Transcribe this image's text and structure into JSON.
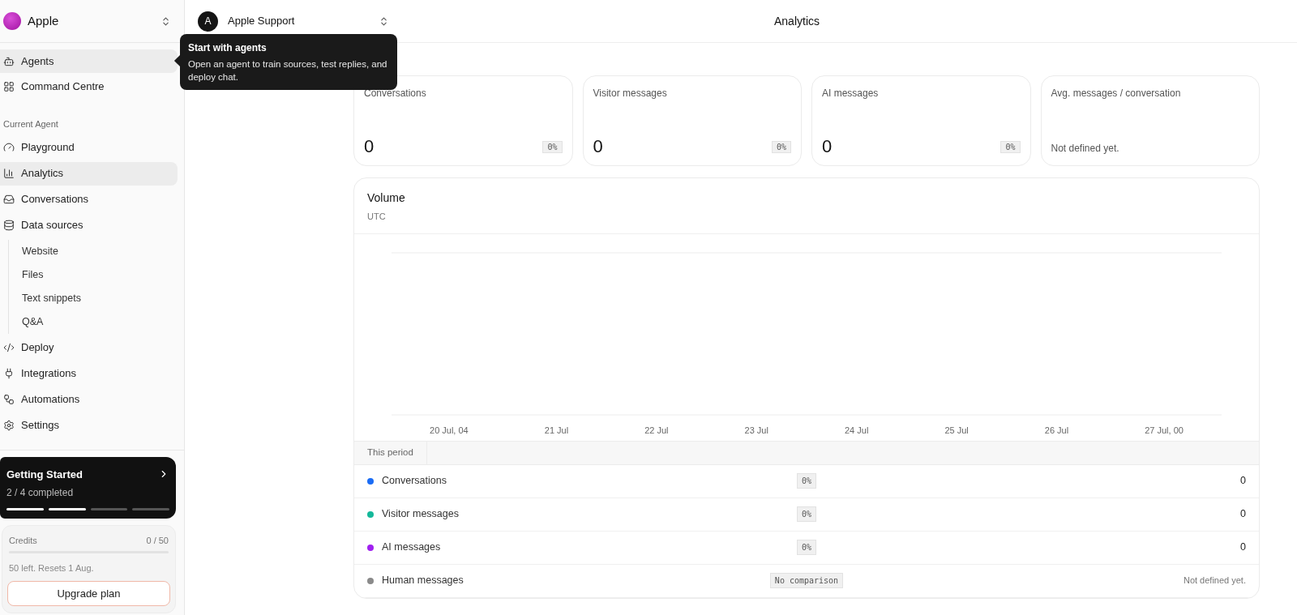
{
  "workspace": {
    "name": "Apple"
  },
  "agent": {
    "initial": "A",
    "name": "Apple Support"
  },
  "page_title": "Analytics",
  "tooltip": {
    "title": "Start with agents",
    "text": "Open an agent to train sources, test replies, and deploy chat."
  },
  "sidebar": {
    "items": [
      {
        "label": "Agents",
        "selected": true
      },
      {
        "label": "Command Centre",
        "selected": false
      }
    ],
    "section": "Current Agent",
    "agent_items": [
      {
        "label": "Playground",
        "selected": false
      },
      {
        "label": "Analytics",
        "selected": true
      },
      {
        "label": "Conversations",
        "selected": false
      },
      {
        "label": "Data sources",
        "selected": false,
        "children": [
          {
            "label": "Website"
          },
          {
            "label": "Files"
          },
          {
            "label": "Text snippets"
          },
          {
            "label": "Q&A"
          }
        ]
      },
      {
        "label": "Deploy",
        "selected": false
      },
      {
        "label": "Integrations",
        "selected": false
      },
      {
        "label": "Automations",
        "selected": false
      },
      {
        "label": "Settings",
        "selected": false
      }
    ]
  },
  "getting_started": {
    "title": "Getting Started",
    "progress": "2 / 4 completed",
    "steps": [
      {
        "done": true
      },
      {
        "done": true
      },
      {
        "done": false
      },
      {
        "done": false
      }
    ]
  },
  "credits": {
    "label": "Credits",
    "count": "0 / 50",
    "level": 0,
    "note": "50 left. Resets 1 Aug.",
    "button": "Upgrade plan"
  },
  "metrics": [
    {
      "kind": "delta",
      "label": "Conversations",
      "value": "0",
      "badge": "0%"
    },
    {
      "kind": "delta",
      "label": "Visitor messages",
      "value": "0",
      "badge": "0%"
    },
    {
      "kind": "delta",
      "label": "AI messages",
      "value": "0",
      "badge": "0%"
    },
    {
      "kind": "note",
      "label": "Avg. messages / conversation",
      "note": "Not defined yet."
    }
  ],
  "volume": {
    "title": "Volume",
    "subtitle": "UTC",
    "x_labels": [
      "20 Jul, 04",
      "21 Jul",
      "22 Jul",
      "23 Jul",
      "24 Jul",
      "25 Jul",
      "26 Jul",
      "27 Jul, 00"
    ],
    "period_label": "This period",
    "rows": [
      {
        "kind": "value",
        "color": "#1a6cf5",
        "label": "Conversations",
        "badge": "0%",
        "value": "0"
      },
      {
        "kind": "value",
        "color": "#14b89a",
        "label": "Visitor messages",
        "badge": "0%",
        "value": "0"
      },
      {
        "kind": "value",
        "color": "#a020f0",
        "label": "AI messages",
        "badge": "0%",
        "value": "0"
      },
      {
        "kind": "note",
        "color": "#8a8a8a",
        "label": "Human messages",
        "badge": "No comparison",
        "value": "Not defined yet."
      }
    ]
  }
}
